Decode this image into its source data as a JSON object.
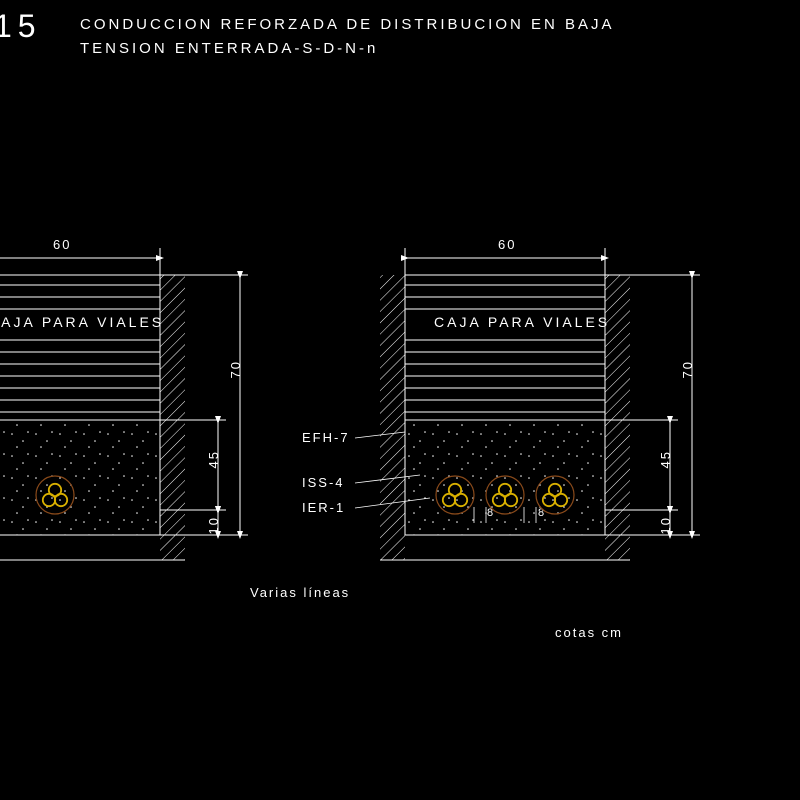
{
  "title_number": "15",
  "title_line1": "CONDUCCION REFORZADA DE DISTRIBUCION EN BAJA",
  "title_line2": "TENSION ENTERRADA-S-D-N-n",
  "section_label": "CAJA PARA VIALES",
  "layers": {
    "top": "EFH-7",
    "mid": "ISS-4",
    "bot": "IER-1"
  },
  "dims": {
    "width": "60",
    "d70": "70",
    "d45": "45",
    "d10": "10",
    "gap": "8"
  },
  "caption_left": "Varias líneas",
  "caption_right": "cotas cm"
}
